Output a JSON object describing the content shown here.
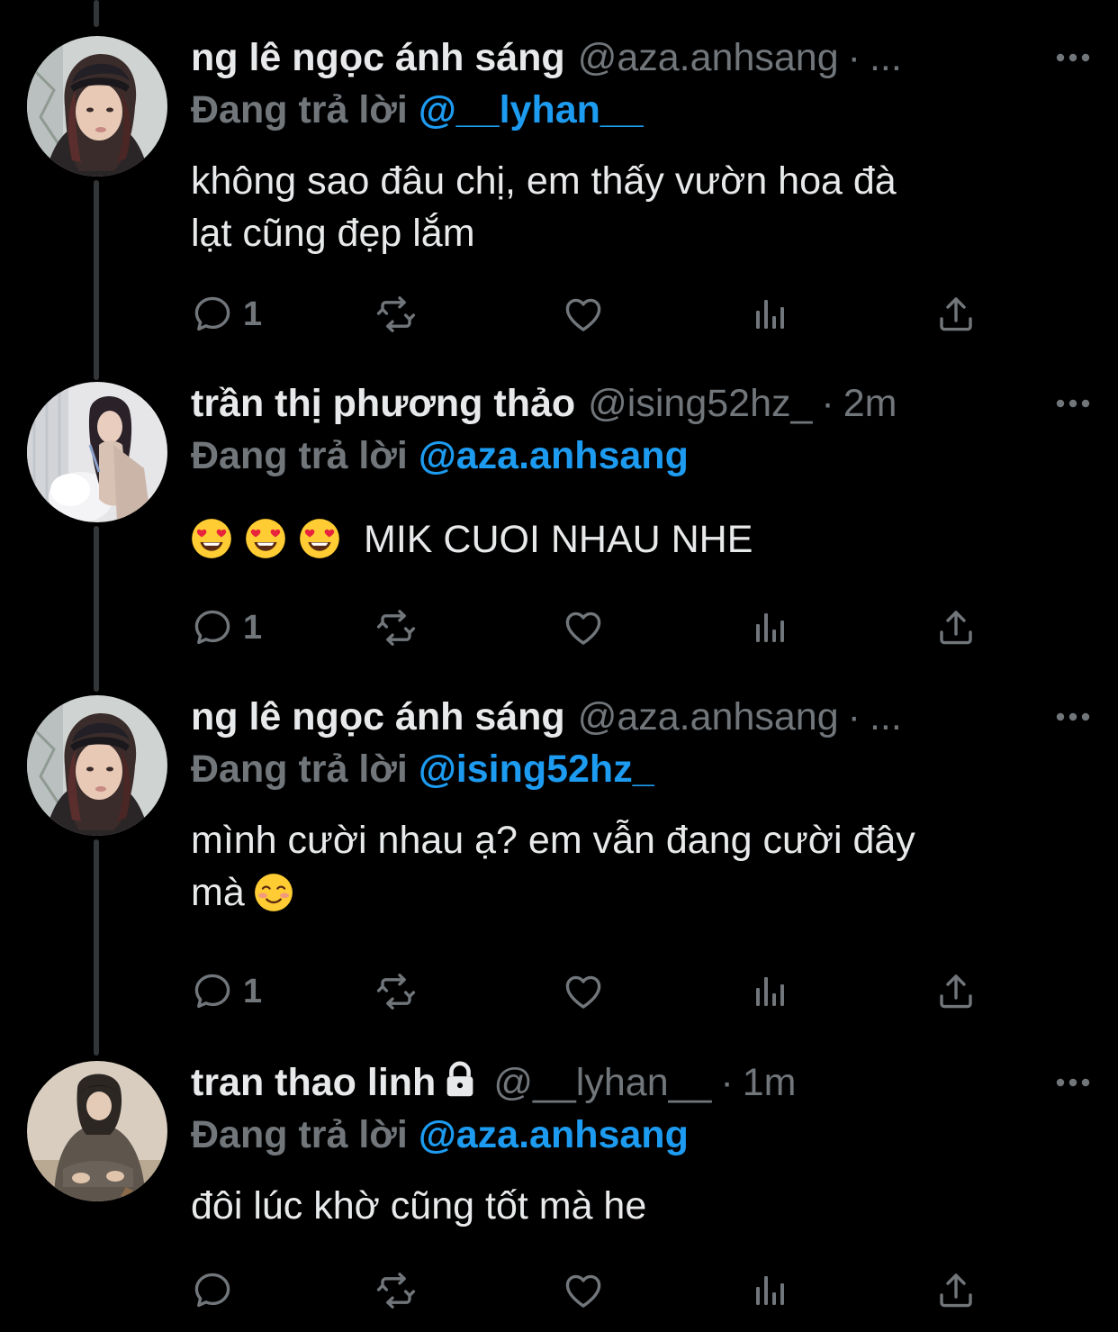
{
  "colors": {
    "background": "#000000",
    "text_primary": "#e7e9ea",
    "text_secondary": "#71767b",
    "accent": "#1d9bf0",
    "thread_line": "#333639"
  },
  "tweets": [
    {
      "name": "ng lê ngọc ánh sáng",
      "handle": "@aza.anhsang",
      "separator": "·",
      "time": "...",
      "reply_label": "Đang trả lời",
      "reply_to": "@__lyhan__",
      "text_line1": "không sao đâu chị, em thấy vườn hoa đà",
      "text_line2": "lạt cũng đẹp lắm",
      "reply_count": "1",
      "avatar_icon": "avatar-girl-helmet"
    },
    {
      "name": "trần thị phương thảo",
      "handle": "@ising52hz_",
      "separator": "·",
      "time": "2m",
      "reply_label": "Đang trả lời",
      "reply_to": "@aza.anhsang",
      "text": "MIK CUOI NHAU NHE",
      "emoji_icons": [
        "heart-eyes-emoji",
        "heart-eyes-emoji",
        "heart-eyes-emoji"
      ],
      "reply_count": "1",
      "avatar_icon": "avatar-girl-light"
    },
    {
      "name": "ng lê ngọc ánh sáng",
      "handle": "@aza.anhsang",
      "separator": "·",
      "time": "...",
      "reply_label": "Đang trả lời",
      "reply_to": "@ising52hz_",
      "text_line1": "mình cười nhau ạ? em vẫn đang cười đây",
      "text_line2": "mà",
      "trailing_emoji_icon": "smiling-blush-emoji",
      "reply_count": "1",
      "avatar_icon": "avatar-girl-helmet"
    },
    {
      "name": "tran thao linh",
      "name_icon": "lock-icon",
      "handle": "@__lyhan__",
      "separator": "·",
      "time": "1m",
      "reply_label": "Đang trả lời",
      "reply_to": "@aza.anhsang",
      "text": "đôi lúc khờ cũng tốt mà he",
      "reply_count": "",
      "avatar_icon": "avatar-person-sitting"
    }
  ],
  "action_icons": [
    "reply-icon",
    "retweet-icon",
    "like-icon",
    "views-icon",
    "share-icon"
  ],
  "more_icon": "more-options-icon"
}
